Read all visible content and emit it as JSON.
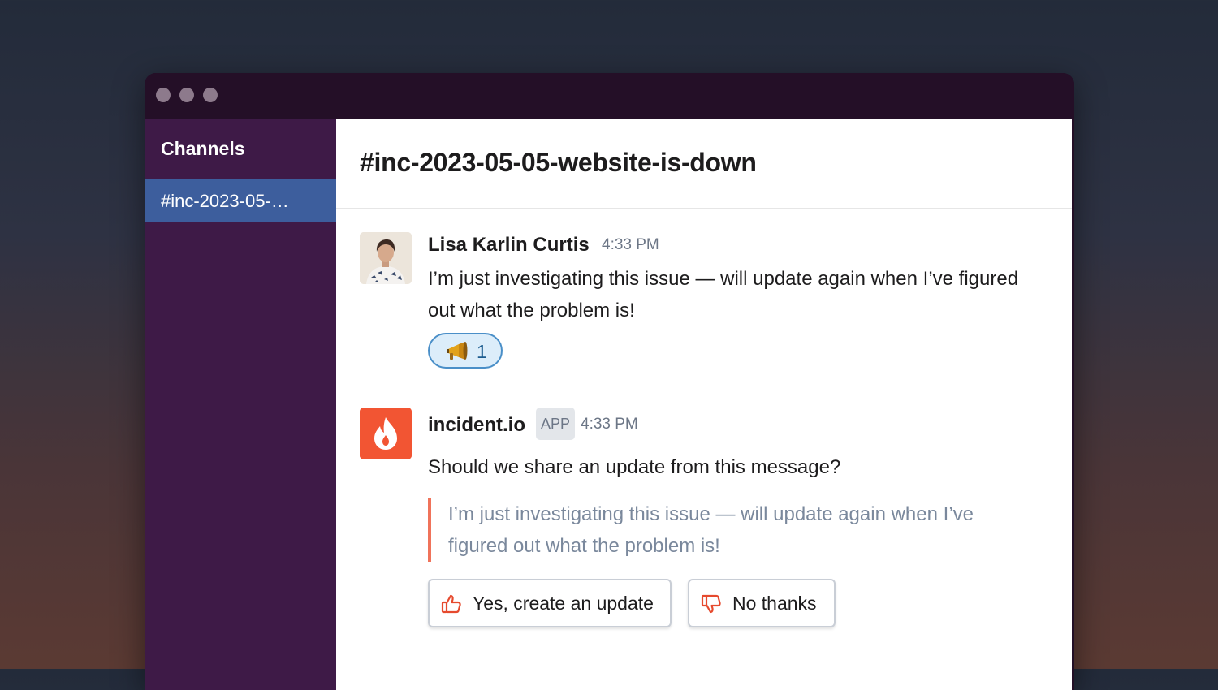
{
  "window": {
    "controls": [
      "window-dot",
      "window-dot",
      "window-dot"
    ]
  },
  "sidebar": {
    "heading": "Channels",
    "items": [
      {
        "label": "#inc-2023-05-…",
        "selected": true
      }
    ]
  },
  "channel": {
    "title": "#inc-2023-05-05-website-is-down"
  },
  "messages": [
    {
      "author": "Lisa Karlin Curtis",
      "time": "4:33 PM",
      "avatar": "user-photo-avatar",
      "text_line1": "I’m just investigating this issue — will update again when I’ve figured",
      "text_line2": "out what the problem is!",
      "reaction": {
        "emoji": "megaphone-icon",
        "count": "1"
      }
    },
    {
      "author": "incident.io",
      "badge": "APP",
      "time": "4:33 PM",
      "avatar": "flame-icon",
      "text": "Should we share an update from this message?",
      "quote_line1": "I’m just investigating this issue — will update again when I’ve",
      "quote_line2": "figured out what the problem is!",
      "actions": {
        "yes_label": "Yes, create an update",
        "no_label": "No thanks"
      }
    }
  ],
  "colors": {
    "sidebar_bg": "#3e1a47",
    "selected_channel": "#3d5e9d",
    "brand_accent": "#f25533",
    "reaction_border": "#4a8fc8"
  }
}
